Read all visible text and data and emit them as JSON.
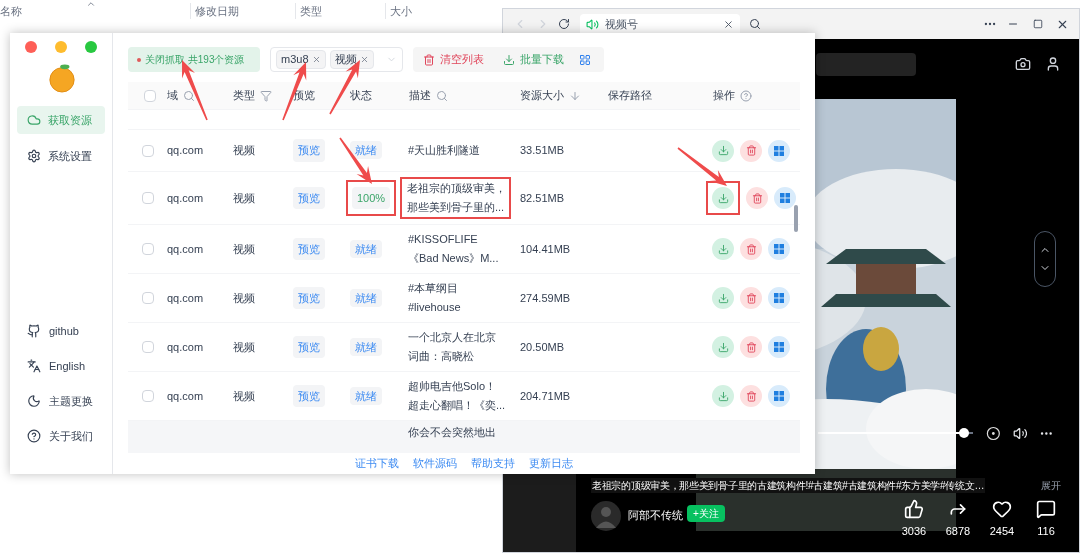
{
  "explorer": {
    "columns": [
      "名称",
      "修改日期",
      "类型",
      "大小"
    ]
  },
  "browser": {
    "tab": {
      "title": "视频号"
    },
    "caption": "老祖宗的顶级审美，那些美到骨子里的古建筑构件!#古建筑#古建筑构件#东方美学#传统文…",
    "expand": "展开",
    "author": "阿部不传统",
    "follow": "+关注",
    "progress": {
      "level": 0.94
    },
    "stats": [
      {
        "kind": "like",
        "count": "3036"
      },
      {
        "kind": "share",
        "count": "6878"
      },
      {
        "kind": "favorite",
        "count": "2454"
      },
      {
        "kind": "comment",
        "count": "116"
      }
    ]
  },
  "app": {
    "nav": [
      {
        "kind": "resources",
        "label": "获取资源",
        "selected": true
      },
      {
        "kind": "settings",
        "label": "系统设置",
        "selected": false
      }
    ],
    "links": [
      {
        "kind": "github",
        "label": "github"
      },
      {
        "kind": "language",
        "label": "English"
      },
      {
        "kind": "theme",
        "label": "主题更换"
      },
      {
        "kind": "about",
        "label": "关于我们"
      }
    ],
    "capture_status": "关闭抓取 共193个资源",
    "filters": [
      "m3u8",
      "视频"
    ],
    "clear_button": "清空列表",
    "batch_button": "批量下载",
    "header_checked": false,
    "columns": [
      {
        "label": "域",
        "kind": "search"
      },
      {
        "label": "类型",
        "kind": "filter"
      },
      {
        "label": "预览",
        "kind": "plain"
      },
      {
        "label": "状态",
        "kind": "plain"
      },
      {
        "label": "描述",
        "kind": "search"
      },
      {
        "label": "资源大小",
        "kind": "sort"
      },
      {
        "label": "保存路径",
        "kind": "plain"
      },
      {
        "label": "操作",
        "kind": "help"
      }
    ],
    "rows": [
      {
        "checked": false,
        "domain": "qq.com",
        "type": "视频",
        "preview": "预览",
        "status": {
          "kind": "ready",
          "text": "就绪"
        },
        "description": [
          "#天山胜利隧道"
        ],
        "size": "33.51MB",
        "marked": false
      },
      {
        "checked": false,
        "domain": "qq.com",
        "type": "视频",
        "preview": "预览",
        "status": {
          "kind": "progress",
          "text": "100%"
        },
        "description": [
          "老祖宗的顶级审美，",
          "那些美到骨子里的..."
        ],
        "size": "82.51MB",
        "marked": true
      },
      {
        "checked": false,
        "domain": "qq.com",
        "type": "视频",
        "preview": "预览",
        "status": {
          "kind": "ready",
          "text": "就绪"
        },
        "description": [
          "#KISSOFLIFE",
          "《Bad News》M..."
        ],
        "size": "104.41MB",
        "marked": false
      },
      {
        "checked": false,
        "domain": "qq.com",
        "type": "视频",
        "preview": "预览",
        "status": {
          "kind": "ready",
          "text": "就绪"
        },
        "description": [
          "#本草纲目",
          "#livehouse"
        ],
        "size": "274.59MB",
        "marked": false
      },
      {
        "checked": false,
        "domain": "qq.com",
        "type": "视频",
        "preview": "预览",
        "status": {
          "kind": "ready",
          "text": "就绪"
        },
        "description": [
          "一个北京人在北京",
          "词曲：高晓松"
        ],
        "size": "20.50MB",
        "marked": false
      },
      {
        "checked": false,
        "domain": "qq.com",
        "type": "视频",
        "preview": "预览",
        "status": {
          "kind": "ready",
          "text": "就绪"
        },
        "description": [
          "超帅电吉他Solo！",
          "超走心翻唱！《奕..."
        ],
        "size": "204.71MB",
        "marked": false
      }
    ],
    "partial_row": {
      "description": "你会不会突然地出"
    },
    "footer": [
      "证书下载",
      "软件源码",
      "帮助支持",
      "更新日志"
    ]
  }
}
